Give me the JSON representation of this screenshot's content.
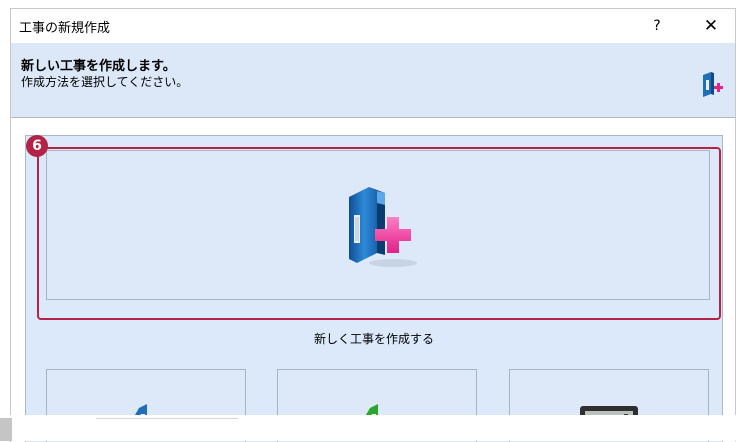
{
  "dialog": {
    "title": "工事の新規作成",
    "help": "?",
    "close": "✕"
  },
  "header": {
    "title": "新しい工事を作成します。",
    "subtitle": "作成方法を選択してください。"
  },
  "main": {
    "create_label": "新しく工事を作成する",
    "badge": "6"
  },
  "colors": {
    "header_bg": "#dce8f7",
    "body_bg": "#dbe9fb",
    "highlight": "#b42346"
  }
}
